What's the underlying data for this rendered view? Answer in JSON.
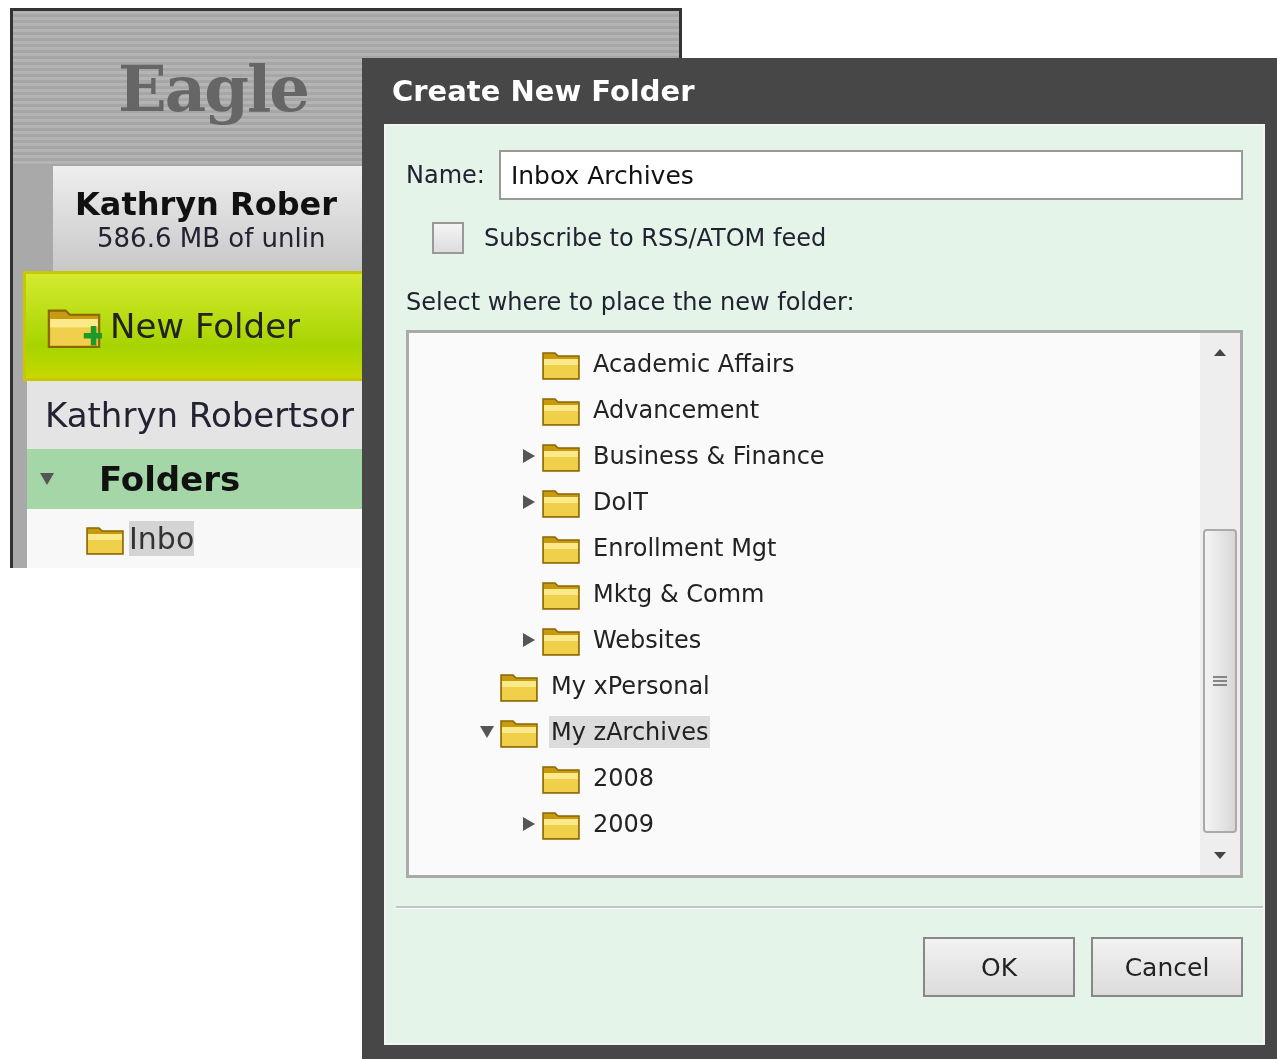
{
  "background_app": {
    "logo": "Eagle",
    "user_name": "Kathryn Rober",
    "quota": "586.6 MB of unlin",
    "new_folder_button": "New Folder",
    "account": "Kathryn Robertsor",
    "folders_header": {
      "label": "Folders",
      "expanded": true
    },
    "first_folder": {
      "label": "Inbo",
      "selected": true
    }
  },
  "dialog": {
    "title": "Create New Folder",
    "name_label": "Name:",
    "name_value": "Inbox Archives",
    "subscribe": {
      "label": "Subscribe to RSS/ATOM feed",
      "checked": false
    },
    "place_label": "Select where to place the new folder:",
    "tree": {
      "items": [
        {
          "children": [
            {
              "label": "Academic Affairs",
              "kind": "leaf",
              "selected": false
            },
            {
              "label": "Advancement",
              "kind": "leaf",
              "selected": false
            },
            {
              "label": "Business & Finance",
              "kind": "branch",
              "expanded": false,
              "selected": false
            },
            {
              "label": "DoIT",
              "kind": "branch",
              "expanded": false,
              "selected": false
            },
            {
              "label": "Enrollment Mgt",
              "kind": "leaf",
              "selected": false
            },
            {
              "label": "Mktg & Comm",
              "kind": "leaf",
              "selected": false
            },
            {
              "label": "Websites",
              "kind": "branch",
              "expanded": false,
              "selected": false
            }
          ]
        },
        {
          "label": "My xPersonal",
          "kind": "leaf",
          "selected": false
        },
        {
          "label": "My zArchives",
          "kind": "branch",
          "expanded": true,
          "selected": true,
          "children": [
            {
              "label": "2008",
              "kind": "leaf",
              "selected": false
            },
            {
              "label": "2009",
              "kind": "branch",
              "expanded": false,
              "selected": false
            }
          ]
        }
      ]
    },
    "buttons": [
      "OK",
      "Cancel"
    ]
  }
}
